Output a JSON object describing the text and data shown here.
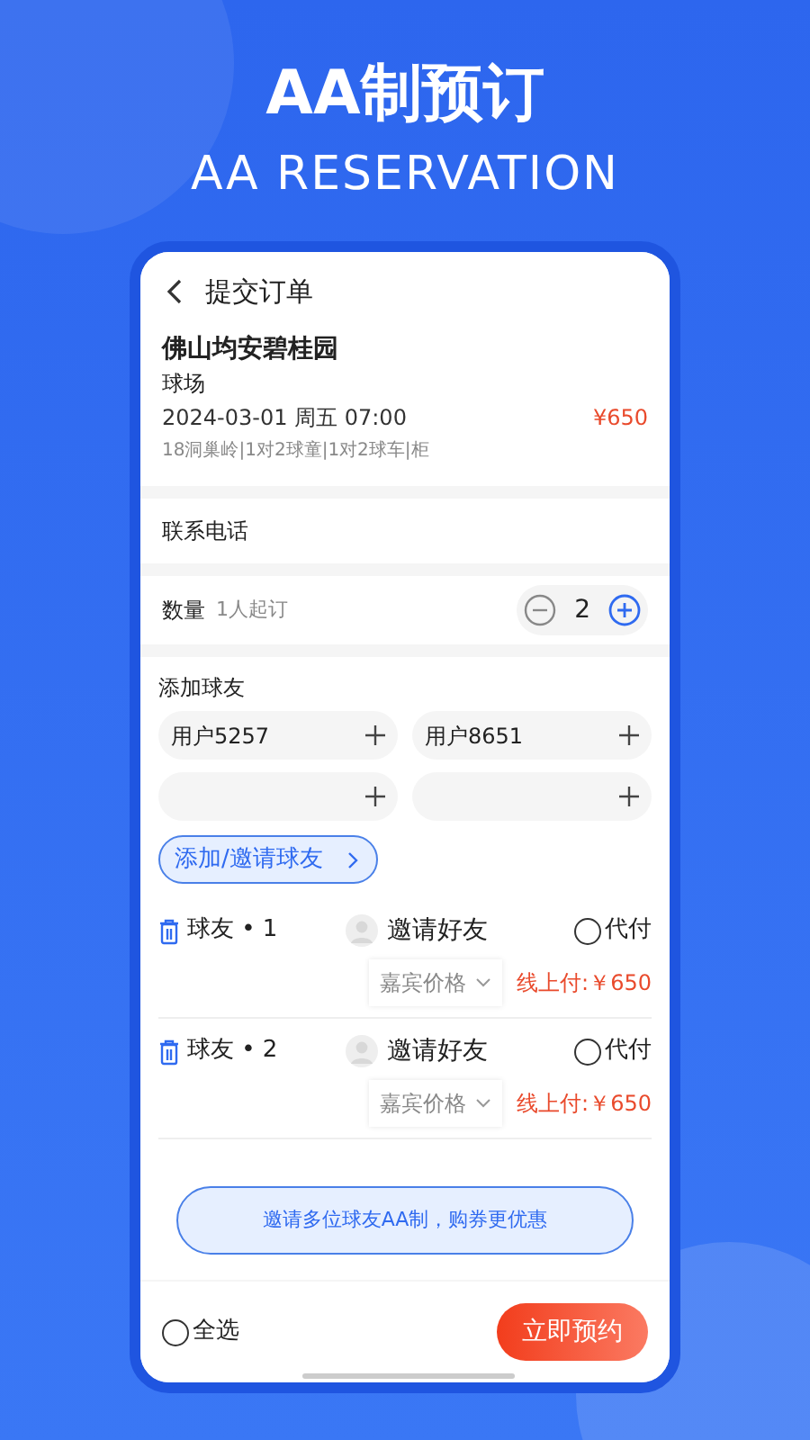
{
  "headline": "AA制预订",
  "subheadline": "AA RESERVATION",
  "nav": {
    "title": "提交订单"
  },
  "venue": {
    "name": "佛山均安碧桂园",
    "type": "球场",
    "datetime": "2024-03-01 周五 07:00",
    "price": "¥650",
    "details": "18洞巢岭|1对2球童|1对2球车|柜"
  },
  "contact": {
    "label": "联系电话"
  },
  "quantity": {
    "label": "数量",
    "hint": "1人起订",
    "value": "2"
  },
  "add_friends": {
    "label": "添加球友",
    "slots": [
      {
        "kind": "user",
        "name": "用户5257"
      },
      {
        "kind": "user",
        "name": "用户8651"
      },
      {
        "kind": "empty"
      },
      {
        "kind": "empty"
      }
    ],
    "invite_button": "添加/邀请球友"
  },
  "players": [
    {
      "label": "球友 • 1",
      "invite": "邀请好友",
      "pay_label": "代付",
      "pay_selected": false,
      "price_option": "嘉宾价格",
      "online_price": "线上付:￥650"
    },
    {
      "label": "球友 • 2",
      "invite": "邀请好友",
      "pay_label": "代付",
      "pay_selected": false,
      "price_option": "嘉宾价格",
      "online_price": "线上付:￥650"
    }
  ],
  "promo": "邀请多位球友AA制，购券更优惠",
  "footer": {
    "select_all": "全选",
    "select_all_checked": false,
    "submit": "立即预约"
  }
}
